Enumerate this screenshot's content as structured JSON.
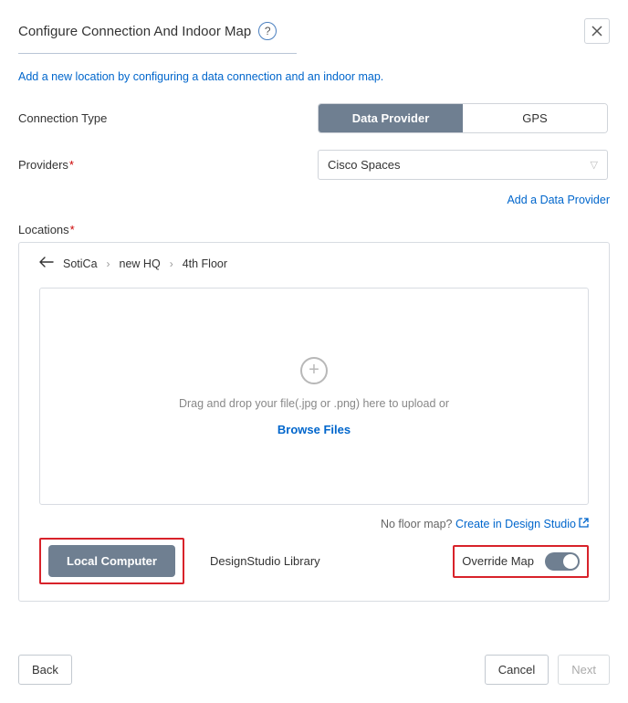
{
  "header": {
    "title": "Configure Connection And Indoor Map"
  },
  "description": "Add a new location by configuring a data connection and an indoor map.",
  "form": {
    "connection_type_label": "Connection Type",
    "connection_type_options": {
      "data_provider": "Data Provider",
      "gps": "GPS"
    },
    "providers_label": "Providers",
    "providers_selected": "Cisco Spaces",
    "add_provider_link": "Add a Data Provider"
  },
  "locations": {
    "label": "Locations",
    "breadcrumb": [
      "SotiCa",
      "new HQ",
      "4th Floor"
    ],
    "upload_hint": "Drag and drop your file(.jpg or .png) here to upload or",
    "browse_label": "Browse Files",
    "no_floor_text": "No floor map?",
    "create_link": "Create in Design Studio",
    "tabs": {
      "local": "Local Computer",
      "library": "DesignStudio Library"
    },
    "override_label": "Override Map"
  },
  "footer": {
    "back": "Back",
    "cancel": "Cancel",
    "next": "Next"
  }
}
